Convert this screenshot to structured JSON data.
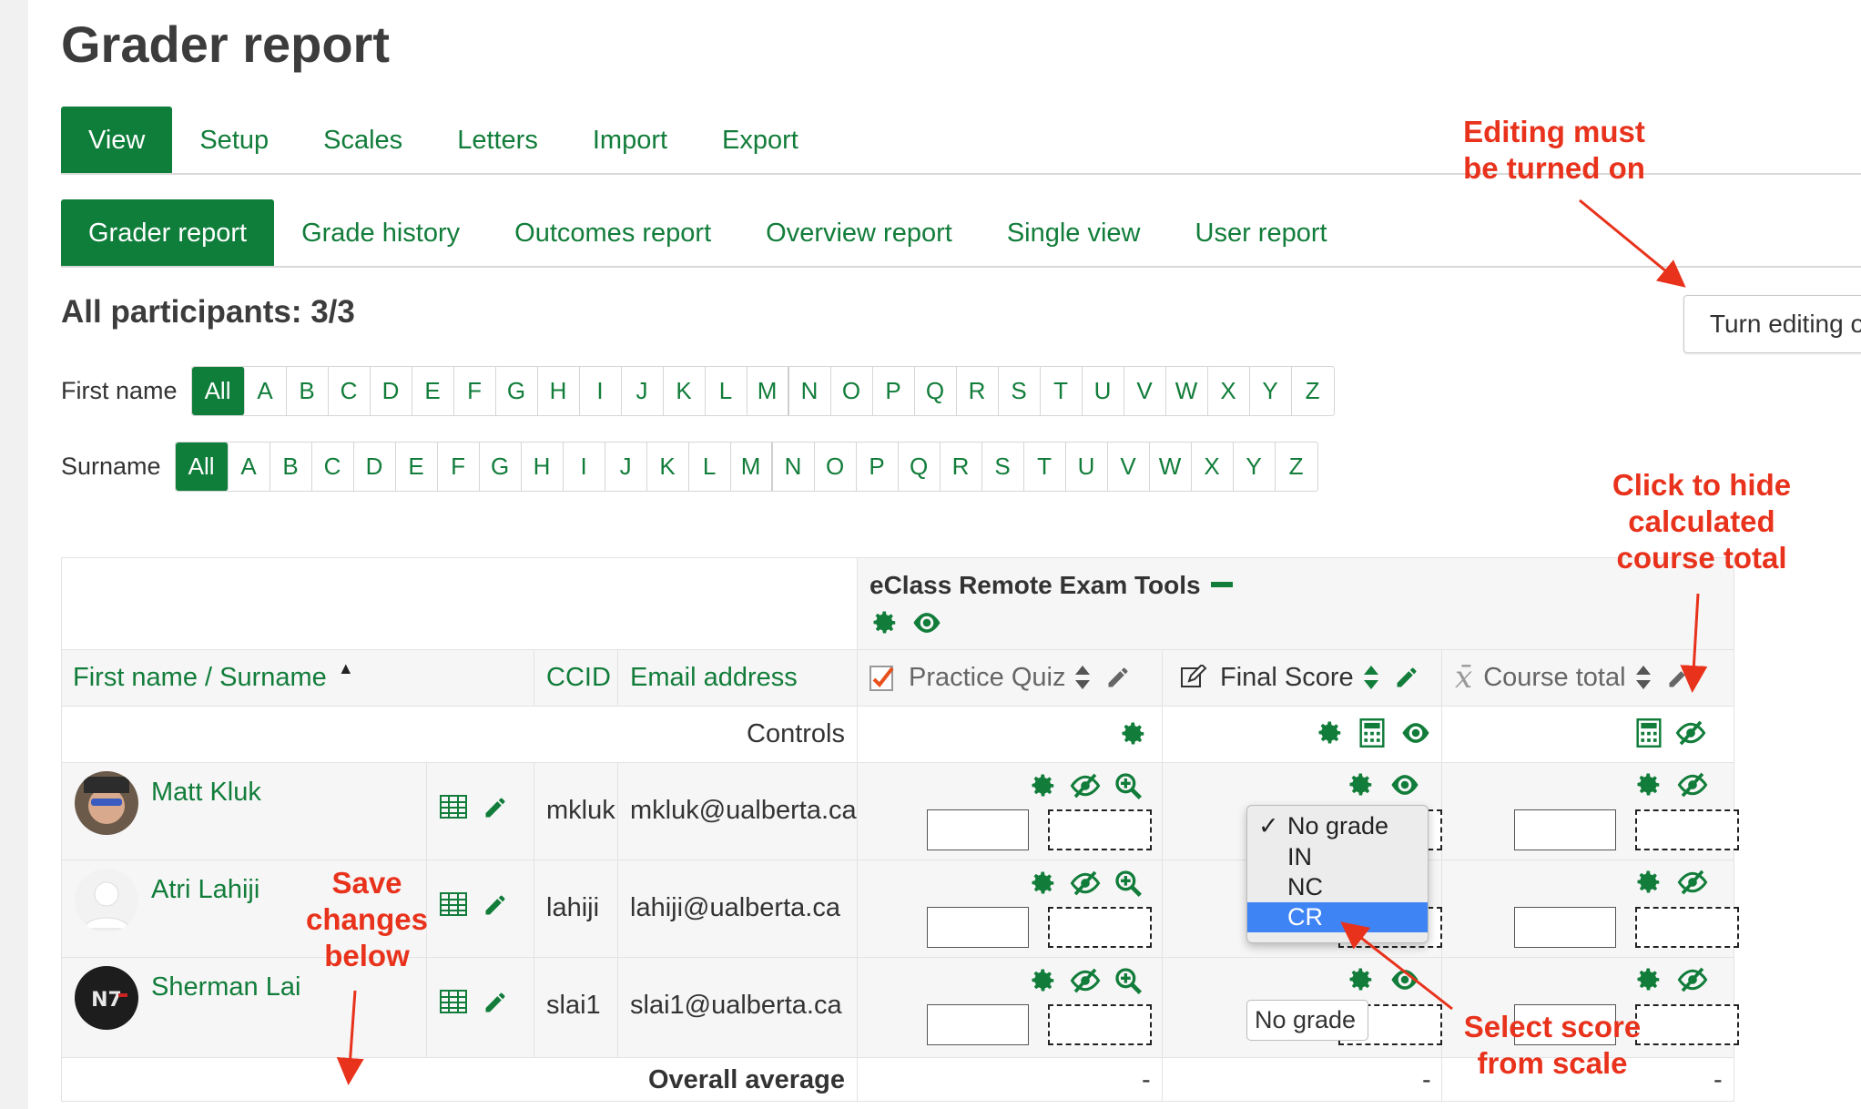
{
  "page_title": "Grader report",
  "tabs_primary": [
    {
      "label": "View",
      "active": true
    },
    {
      "label": "Setup",
      "active": false
    },
    {
      "label": "Scales",
      "active": false
    },
    {
      "label": "Letters",
      "active": false
    },
    {
      "label": "Import",
      "active": false
    },
    {
      "label": "Export",
      "active": false
    }
  ],
  "tabs_secondary": [
    {
      "label": "Grader report",
      "active": true
    },
    {
      "label": "Grade history",
      "active": false
    },
    {
      "label": "Outcomes report",
      "active": false
    },
    {
      "label": "Overview report",
      "active": false
    },
    {
      "label": "Single view",
      "active": false
    },
    {
      "label": "User report",
      "active": false
    }
  ],
  "participants_heading": "All participants: 3/3",
  "edit_button_label": "Turn editing off",
  "firstname_filter": {
    "label": "First name",
    "all_label": "All"
  },
  "surname_filter": {
    "label": "Surname",
    "all_label": "All"
  },
  "letters": [
    "A",
    "B",
    "C",
    "D",
    "E",
    "F",
    "G",
    "H",
    "I",
    "J",
    "K",
    "L",
    "M",
    "N",
    "O",
    "P",
    "Q",
    "R",
    "S",
    "T",
    "U",
    "V",
    "W",
    "X",
    "Y",
    "Z"
  ],
  "table": {
    "category_title": "eClass Remote Exam Tools",
    "headers": {
      "name": "First name / Surname",
      "name_sort": "▲",
      "ccid": "CCID",
      "email": "Email address",
      "quiz": "Practice Quiz",
      "final": "Final Score",
      "total": "Course total"
    },
    "controls_label": "Controls",
    "average_label": "Overall average",
    "average_values": [
      "-",
      "-",
      "-"
    ],
    "rows": [
      {
        "name": "Matt Kluk",
        "ccid": "mkluk",
        "email": "mkluk@ualberta.ca"
      },
      {
        "name": "Atri Lahiji",
        "ccid": "lahiji",
        "email": "lahiji@ualberta.ca"
      },
      {
        "name": "Sherman Lai",
        "ccid": "slai1",
        "email": "slai1@ualberta.ca"
      }
    ],
    "scale_select_value": "No grade"
  },
  "dropdown": {
    "options": [
      "No grade",
      "IN",
      "NC",
      "CR"
    ],
    "checked": "No grade",
    "highlighted": "CR",
    "check_mark": "✓"
  },
  "annotations": {
    "editing": "Editing must be turned on",
    "hide_total": "Click to hide calculated course total",
    "save": "Save changes below",
    "select": "Select  score from scale"
  },
  "colors": {
    "brand_green": "#0f7e3b",
    "annotation_red": "#e8321c",
    "highlight_blue": "#3f84f5"
  }
}
